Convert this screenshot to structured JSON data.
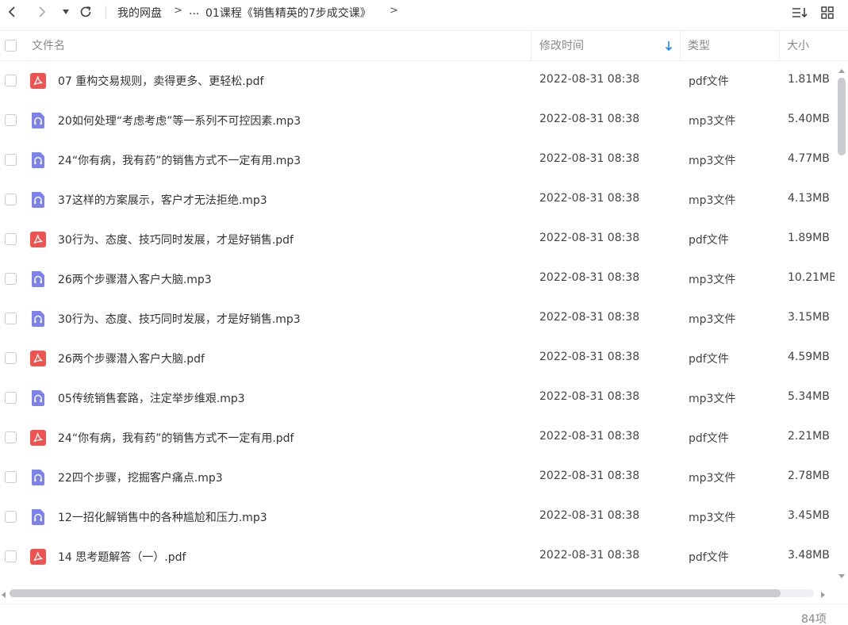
{
  "breadcrumb": {
    "root": "我的网盘",
    "ellipsis": "...",
    "current": "01课程《销售精英的7步成交课》"
  },
  "columns": {
    "name": "文件名",
    "modified": "修改时间",
    "type": "类型",
    "size": "大小"
  },
  "files": [
    {
      "name": "07 重构交易规则，卖得更多、更轻松.pdf",
      "date": "2022-08-31 08:38",
      "type": "pdf文件",
      "size": "1.81MB",
      "icon": "pdf-icon"
    },
    {
      "name": "20如何处理“考虑考虑”等一系列不可控因素.mp3",
      "date": "2022-08-31 08:38",
      "type": "mp3文件",
      "size": "5.40MB",
      "icon": "audio-icon"
    },
    {
      "name": "24“你有病，我有药”的销售方式不一定有用.mp3",
      "date": "2022-08-31 08:38",
      "type": "mp3文件",
      "size": "4.77MB",
      "icon": "audio-icon"
    },
    {
      "name": "37这样的方案展示，客户才无法拒绝.mp3",
      "date": "2022-08-31 08:38",
      "type": "mp3文件",
      "size": "4.13MB",
      "icon": "audio-icon"
    },
    {
      "name": "30行为、态度、技巧同时发展，才是好销售.pdf",
      "date": "2022-08-31 08:38",
      "type": "pdf文件",
      "size": "1.89MB",
      "icon": "pdf-icon"
    },
    {
      "name": "26两个步骤潜入客户大脑.mp3",
      "date": "2022-08-31 08:38",
      "type": "mp3文件",
      "size": "10.21MB",
      "icon": "audio-icon"
    },
    {
      "name": "30行为、态度、技巧同时发展，才是好销售.mp3",
      "date": "2022-08-31 08:38",
      "type": "mp3文件",
      "size": "3.15MB",
      "icon": "audio-icon"
    },
    {
      "name": "26两个步骤潜入客户大脑.pdf",
      "date": "2022-08-31 08:38",
      "type": "pdf文件",
      "size": "4.59MB",
      "icon": "pdf-icon"
    },
    {
      "name": "05传统销售套路，注定举步维艰.mp3",
      "date": "2022-08-31 08:38",
      "type": "mp3文件",
      "size": "5.34MB",
      "icon": "audio-icon"
    },
    {
      "name": "24“你有病，我有药”的销售方式不一定有用.pdf",
      "date": "2022-08-31 08:38",
      "type": "pdf文件",
      "size": "2.21MB",
      "icon": "pdf-icon"
    },
    {
      "name": "22四个步骤，挖掘客户痛点.mp3",
      "date": "2022-08-31 08:38",
      "type": "mp3文件",
      "size": "2.78MB",
      "icon": "audio-icon"
    },
    {
      "name": "12一招化解销售中的各种尴尬和压力.mp3",
      "date": "2022-08-31 08:38",
      "type": "mp3文件",
      "size": "3.45MB",
      "icon": "audio-icon"
    },
    {
      "name": "14 思考题解答（一）.pdf",
      "date": "2022-08-31 08:38",
      "type": "pdf文件",
      "size": "3.48MB",
      "icon": "pdf-icon"
    }
  ],
  "footer": {
    "count": "84项"
  },
  "colors": {
    "pdf": "#ef5350",
    "audio": "#7b83eb",
    "sort_arrow": "#1e88e5",
    "scrollbar": "#c9cbcf"
  }
}
